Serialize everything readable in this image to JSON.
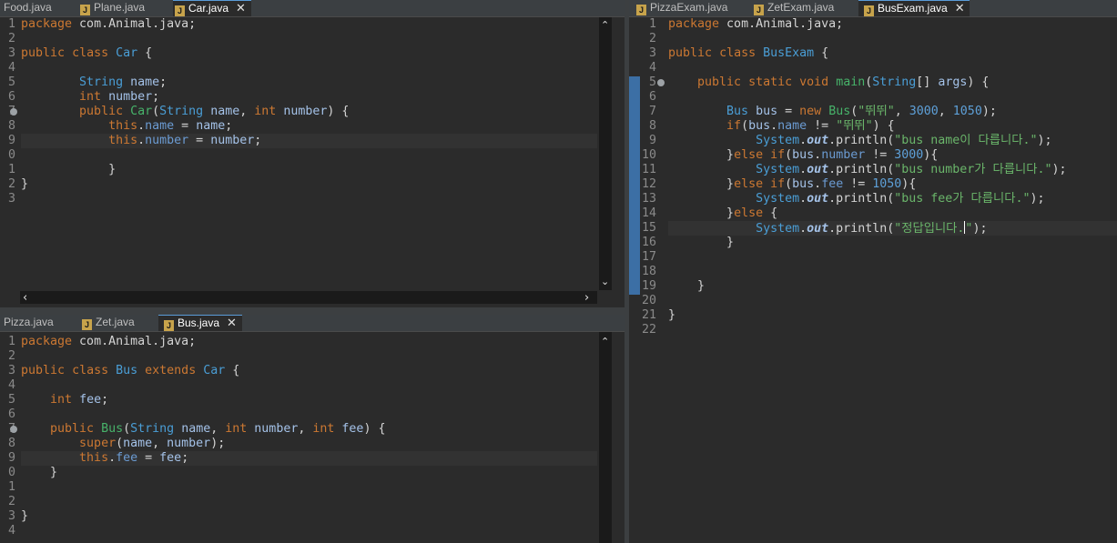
{
  "editors": {
    "top_left": {
      "tabs": [
        {
          "label": "Food.java",
          "active": false
        },
        {
          "label": "Plane.java",
          "active": false
        },
        {
          "label": "Car.java",
          "active": true
        }
      ],
      "line_numbers": [
        "1",
        "2",
        "3",
        "4",
        "5",
        "6",
        "7",
        "8",
        "9",
        "0",
        "1",
        "2",
        "3"
      ],
      "lines": [
        "package com.Animal.java;",
        "",
        "public class Car {",
        "",
        "        String name;",
        "        int number;",
        "        public Car(String name, int number) {",
        "            this.name = name;",
        "            this.number = number;",
        "",
        "        }",
        "}",
        ""
      ]
    },
    "bottom_left": {
      "tabs": [
        {
          "label": "Pizza.java",
          "active": false
        },
        {
          "label": "Zet.java",
          "active": false
        },
        {
          "label": "Bus.java",
          "active": true
        }
      ],
      "line_numbers": [
        "1",
        "2",
        "3",
        "4",
        "5",
        "6",
        "7",
        "8",
        "9",
        "0",
        "1",
        "2",
        "3",
        "4"
      ],
      "lines": [
        "package com.Animal.java;",
        "",
        "public class Bus extends Car {",
        "",
        "    int fee;",
        "",
        "    public Bus(String name, int number, int fee) {",
        "        super(name, number);",
        "        this.fee = fee;",
        "    }",
        "",
        "",
        "}",
        ""
      ]
    },
    "right": {
      "tabs": [
        {
          "label": "PizzaExam.java",
          "active": false
        },
        {
          "label": "ZetExam.java",
          "active": false
        },
        {
          "label": "BusExam.java",
          "active": true
        }
      ],
      "line_numbers": [
        "1",
        "2",
        "3",
        "4",
        "5",
        "6",
        "7",
        "8",
        "9",
        "10",
        "11",
        "12",
        "13",
        "14",
        "15",
        "16",
        "17",
        "18",
        "19",
        "20",
        "21",
        "22"
      ],
      "lines": [
        "package com.Animal.java;",
        "",
        "public class BusExam {",
        "",
        "    public static void main(String[] args) {",
        "",
        "        Bus bus = new Bus(\"뛰뛰\", 3000, 1050);",
        "        if(bus.name != \"뛰뛰\") {",
        "            System.out.println(\"bus name이 다릅니다.\");",
        "        }else if(bus.number != 3000){",
        "            System.out.println(\"bus number가 다릅니다.\");",
        "        }else if(bus.fee != 1050){",
        "            System.out.println(\"bus fee가 다릅니다.\");",
        "        }else {",
        "            System.out.println(\"정답입니다.\");",
        "        }",
        "",
        "",
        "    }",
        "",
        "}",
        ""
      ]
    }
  },
  "colors": {
    "editor_bg": "#2b2b2b",
    "keyword": "#cc7832",
    "type": "#4a9ed6",
    "method": "#47b36a",
    "string": "#6ab56a",
    "number": "#5ea0d8",
    "current_line": "#323232",
    "ruler_marker": "#3c6fa5"
  },
  "icons": {
    "file_icon": "java-file-icon",
    "close_icon": "close-icon",
    "fold_icon": "fold-collapse-icon",
    "scroll_up": "scroll-up-arrow-icon",
    "scroll_down": "scroll-down-arrow-icon",
    "scroll_left": "scroll-left-arrow-icon",
    "scroll_right": "scroll-right-arrow-icon"
  }
}
